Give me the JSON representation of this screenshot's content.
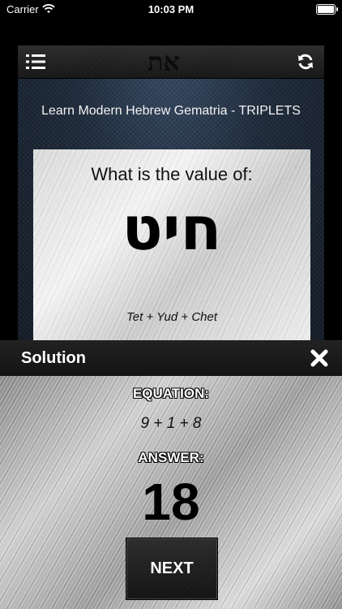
{
  "status_bar": {
    "carrier": "Carrier",
    "time": "10:03 PM"
  },
  "app": {
    "logo_text": "את",
    "title": "Learn Modern Hebrew Gematria - TRIPLETS"
  },
  "card": {
    "question": "What is the value of:",
    "hebrew_word": "חיט",
    "letter_names": "Tet + Yud + Chet"
  },
  "solution": {
    "title": "Solution",
    "equation_label": "EQUATION:",
    "equation": "9 + 1 + 8",
    "answer_label": "ANSWER:",
    "answer": "18",
    "next_label": "NEXT"
  },
  "icons": [
    "wifi-icon",
    "battery-icon",
    "menu-icon",
    "refresh-icon",
    "close-icon"
  ]
}
